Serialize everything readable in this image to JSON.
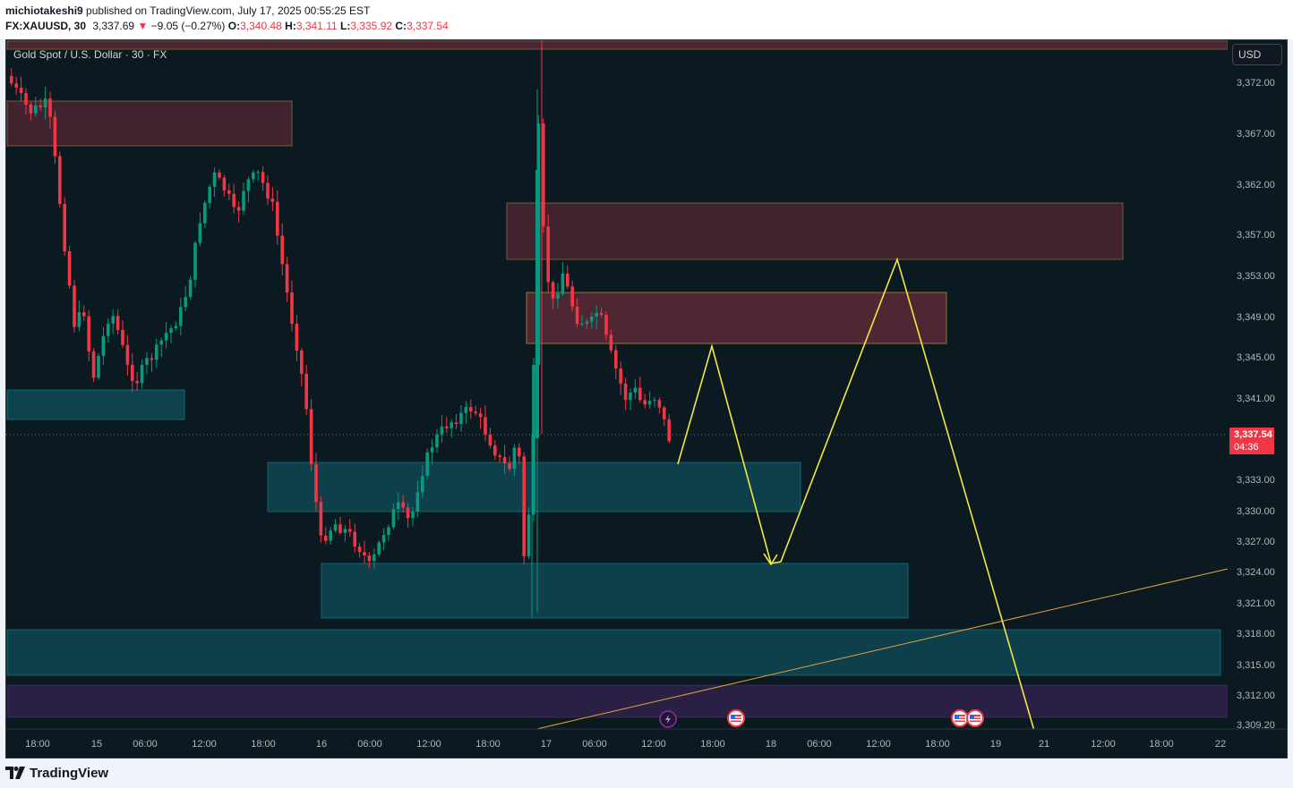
{
  "header": {
    "author": "michiotakeshi9",
    "published_text": "published on TradingView.com, July 17, 2025 00:55:25 EST",
    "symbol": "FX:XAUUSD, 30",
    "last_price": "3,337.69",
    "change_arrow": "▼",
    "change": "−9.05 (−0.27%)",
    "open_label": "O:",
    "open_value": "3,340.48",
    "high_label": "H:",
    "high_value": "3,341.11",
    "low_label": "L:",
    "low_value": "3,335.92",
    "close_label": "C:",
    "close_value": "3,337.54"
  },
  "chart": {
    "title": "Gold Spot / U.S. Dollar · 30 · FX",
    "currency": "USD",
    "current_price": "3,337.54",
    "countdown": "04:36",
    "price_axis": [
      "3,372.00",
      "3,367.00",
      "3,362.00",
      "3,357.00",
      "3,353.00",
      "3,349.00",
      "3,345.00",
      "3,341.00",
      "3,333.00",
      "3,330.00",
      "3,327.00",
      "3,324.00",
      "3,321.00",
      "3,318.00",
      "3,315.00",
      "3,312.00",
      "3,309.20"
    ],
    "time_axis": [
      "18:00",
      "15",
      "06:00",
      "12:00",
      "18:00",
      "16",
      "06:00",
      "12:00",
      "18:00",
      "17",
      "06:00",
      "12:00",
      "18:00",
      "18",
      "06:00",
      "12:00",
      "18:00",
      "19",
      "21",
      "12:00",
      "18:00",
      "22"
    ],
    "event_icons": [
      "lightning-icon",
      "us-flag-icon",
      "us-flag-icon",
      "us-flag-icon"
    ],
    "colors": {
      "background": "#0b1a21",
      "bull_candle": "#089981",
      "bear_candle": "#f23645",
      "supply_zone": "#5a2a36",
      "demand_zone": "#0e5560",
      "projection": "#f5e642",
      "trendline": "#e6a23c"
    }
  },
  "footer": {
    "brand": "TradingView"
  }
}
